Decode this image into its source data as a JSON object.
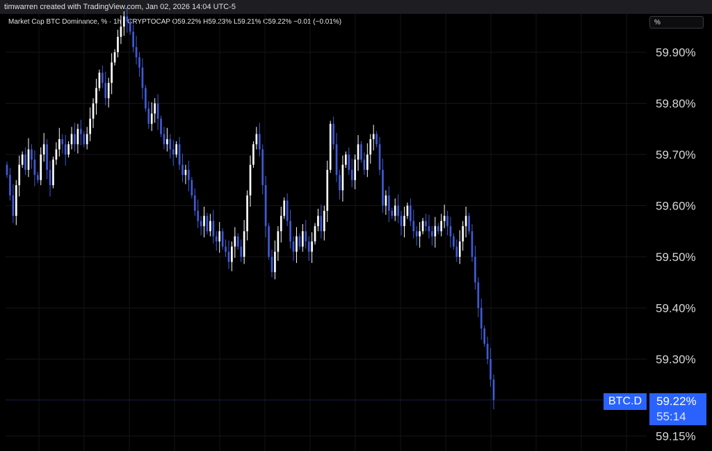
{
  "header": {
    "attribution": "timwarren created with TradingView.com, Jan 02, 2026 14:04 UTC-5"
  },
  "legend": {
    "text": "Market Cap BTC Dominance, % · 1h · CRYPTOCAP O59.22% H59.23% L59.21% C59.22% −0.01 (−0.01%)"
  },
  "scale_mode": "%",
  "colors": {
    "up": "#ffffff",
    "down": "#3f5bd8",
    "accent": "#2962ff",
    "background": "#000000"
  },
  "price_label": {
    "symbol": "BTC.D",
    "price": "59.22%",
    "countdown": "55:14"
  },
  "chart_data": {
    "type": "candlestick",
    "title": "Market Cap BTC Dominance, % · 1h · CRYPTOCAP",
    "ylim": [
      59.14,
      59.99
    ],
    "y_ticks": [
      "59.90%",
      "59.80%",
      "59.70%",
      "59.60%",
      "59.50%",
      "59.40%",
      "59.30%",
      "59.15%"
    ],
    "y_tick_values": [
      59.9,
      59.8,
      59.7,
      59.6,
      59.5,
      59.4,
      59.3,
      59.15
    ],
    "grid": true,
    "last_close": 59.22,
    "closes": [
      59.66,
      59.62,
      59.58,
      59.64,
      59.68,
      59.7,
      59.67,
      59.71,
      59.69,
      59.66,
      59.65,
      59.7,
      59.72,
      59.67,
      59.64,
      59.69,
      59.71,
      59.73,
      59.72,
      59.7,
      59.72,
      59.74,
      59.72,
      59.75,
      59.74,
      59.72,
      59.74,
      59.77,
      59.8,
      59.83,
      59.86,
      59.84,
      59.81,
      59.84,
      59.88,
      59.9,
      59.93,
      59.95,
      59.97,
      59.96,
      59.94,
      59.91,
      59.89,
      59.87,
      59.83,
      59.79,
      59.76,
      59.78,
      59.8,
      59.77,
      59.74,
      59.72,
      59.73,
      59.71,
      59.7,
      59.72,
      59.68,
      59.66,
      59.67,
      59.65,
      59.62,
      59.59,
      59.57,
      59.56,
      59.58,
      59.55,
      59.57,
      59.54,
      59.53,
      59.55,
      59.52,
      59.51,
      59.49,
      59.52,
      59.54,
      59.52,
      59.5,
      59.55,
      59.62,
      59.68,
      59.72,
      59.74,
      59.71,
      59.64,
      59.56,
      59.5,
      59.47,
      59.51,
      59.55,
      59.58,
      59.61,
      59.57,
      59.53,
      59.51,
      59.54,
      59.52,
      59.55,
      59.53,
      59.51,
      59.53,
      59.56,
      59.58,
      59.55,
      59.59,
      59.67,
      59.76,
      59.72,
      59.66,
      59.63,
      59.68,
      59.7,
      59.67,
      59.65,
      59.69,
      59.72,
      59.69,
      59.67,
      59.7,
      59.73,
      59.74,
      59.72,
      59.67,
      59.6,
      59.62,
      59.59,
      59.58,
      59.6,
      59.58,
      59.56,
      59.58,
      59.6,
      59.57,
      59.55,
      59.54,
      59.55,
      59.57,
      59.56,
      59.55,
      59.54,
      59.56,
      59.55,
      59.57,
      59.58,
      59.56,
      59.54,
      59.52,
      59.5,
      59.53,
      59.56,
      59.58,
      59.55,
      59.5,
      59.45,
      59.4,
      59.36,
      59.33,
      59.3,
      59.26,
      59.22
    ]
  }
}
